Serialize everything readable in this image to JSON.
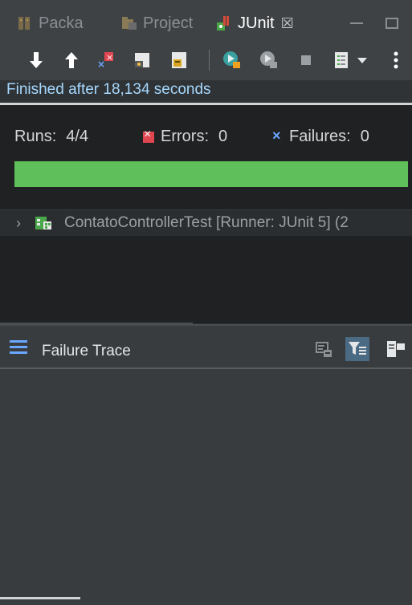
{
  "tabs": [
    {
      "label": "Packa",
      "icon": "package-explorer-icon"
    },
    {
      "label": "Project",
      "icon": "project-explorer-icon"
    },
    {
      "label": "JUnit",
      "icon": "junit-icon",
      "active": true
    }
  ],
  "tab_close_glyph": "☒",
  "toolbar": {
    "buttons": [
      "next-failure-icon",
      "previous-failure-icon",
      "show-failures-only-icon",
      "scroll-lock-icon",
      "show-skipped-icon",
      "rerun-test-icon",
      "rerun-failed-first-icon",
      "stop-icon",
      "test-run-history-icon",
      "view-menu-icon"
    ]
  },
  "status": {
    "text": "Finished after 18,134 seconds"
  },
  "counters": {
    "runs_label": "Runs:",
    "runs_value": "4/4",
    "errors_label": "Errors:",
    "errors_value": "0",
    "failures_label": "Failures:",
    "failures_value": "0"
  },
  "progress": {
    "fraction": 1.0,
    "color": "#5fbf5a"
  },
  "tree": {
    "items": [
      {
        "label": "ContatoControllerTest [Runner: JUnit 5] (2"
      }
    ]
  },
  "failure_trace": {
    "title": "Failure Trace"
  },
  "colors": {
    "accent": "#6aa7ff",
    "error": "#e0464f",
    "success": "#5fbf5a",
    "status_text": "#a6d8ff"
  }
}
